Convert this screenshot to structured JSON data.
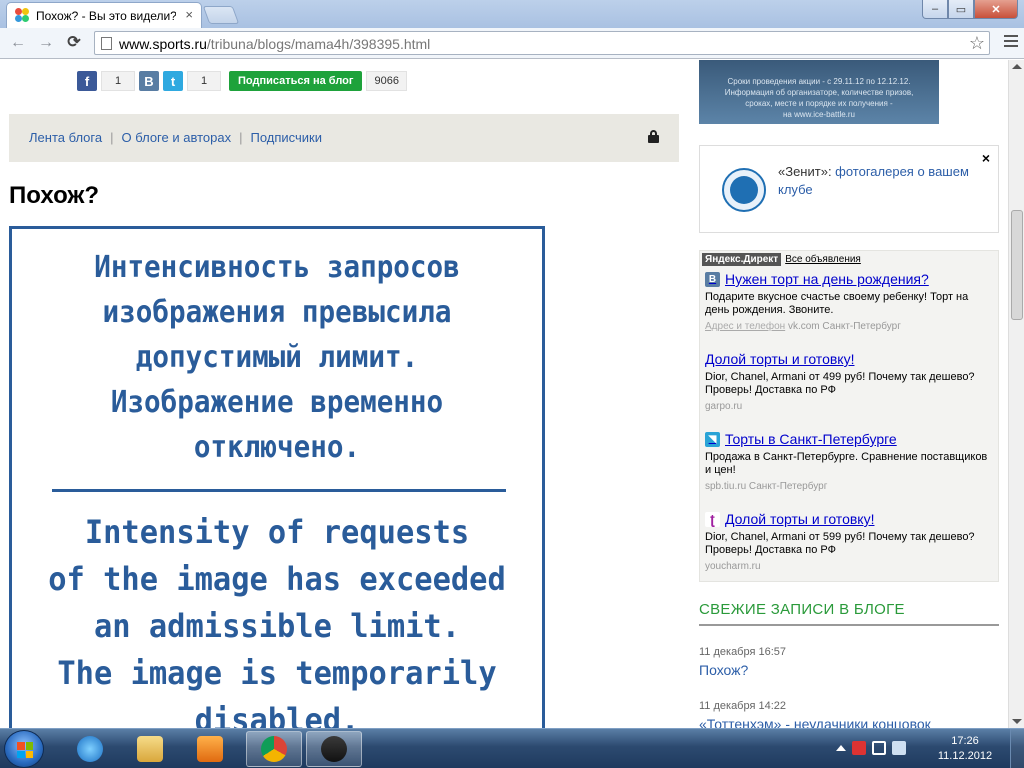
{
  "browser": {
    "tab_title": "Похож? - Вы это видели?",
    "tab_close": "×",
    "url_host": "www.sports.ru",
    "url_path": "/tribuna/blogs/mama4h/398395.html",
    "window_buttons": {
      "minimize": "–",
      "maximize": "▭",
      "close": "✕"
    },
    "nav": {
      "back": "←",
      "forward": "→",
      "reload": "⟳"
    },
    "star": "☆"
  },
  "share": {
    "fb_label": "f",
    "fb_count": "1",
    "vk_label": "B",
    "tw_label": "t",
    "tw_count": "1",
    "subscribe_label": "Подписаться на блог",
    "subscribers_count": "9066"
  },
  "blog_nav": {
    "items": [
      "Лента блога",
      "О блоге и авторах",
      "Подписчики"
    ],
    "separator": "|"
  },
  "post": {
    "title": "Похож?",
    "image_text_ru": [
      "Интенсивность запросов",
      "изображения превысила",
      "допустимый лимит.",
      "Изображение временно",
      "отключено."
    ],
    "image_text_en": [
      "Intensity of requests",
      "of the image has exceeded",
      "an admissible limit.",
      "The image is temporarily",
      "disabled."
    ]
  },
  "sidebar": {
    "promo_lines": [
      "Сроки проведения акции - с 29.11.12 по 12.12.12.",
      "Информация об организаторе, количестве призов,",
      "сроках, месте и порядке их получения -",
      "на www.ice-battle.ru"
    ],
    "zenit": {
      "close": "×",
      "club": "«Зенит»",
      "colon": ": ",
      "link": "фотогалерея о вашем клубе"
    },
    "direct": {
      "badge": "Яндекс.Директ",
      "all_ads": "Все объявления",
      "ads": [
        {
          "icon": "B",
          "title": "Нужен торт на день рождения?",
          "desc": "Подарите вкусное счастье своему ребенку! Торт на день рождения. Звоните.",
          "src_link": "Адрес и телефон",
          "src": "vk.com Санкт-Петербург"
        },
        {
          "icon": "",
          "title": "Долой торты и готовку!",
          "desc": "Dior, Chanel, Armani от 499 руб! Почему так дешево? Проверь! Доставка по РФ",
          "src_link": "",
          "src": "garpo.ru"
        },
        {
          "icon": "◥",
          "title": "Торты в Санкт-Петербурге",
          "desc": "Продажа в Санкт-Петербурге. Сравнение поставщиков и цен!",
          "src_link": "",
          "src": "spb.tiu.ru Санкт-Петербург"
        },
        {
          "icon": "ʈ",
          "title": "Долой торты и готовку!",
          "desc": "Dior, Chanel, Armani от 599 руб! Почему так дешево? Проверь! Доставка по РФ",
          "src_link": "",
          "src": "youcharm.ru"
        }
      ]
    },
    "fresh": {
      "heading": "СВЕЖИЕ ЗАПИСИ В БЛОГЕ",
      "items": [
        {
          "date": "11 декабря 16:57",
          "title": "Похож?"
        },
        {
          "date": "11 декабря 14:22",
          "title": "«Тоттенхэм» - неудачники концовок"
        }
      ]
    }
  },
  "taskbar": {
    "time": "17:26",
    "date": "11.12.2012"
  },
  "colors": {
    "link": "#2c5ea8",
    "subscribe_green": "#1ea23b",
    "fresh_heading": "#2a9a3a",
    "blocked_blue": "#2a5c9a"
  }
}
